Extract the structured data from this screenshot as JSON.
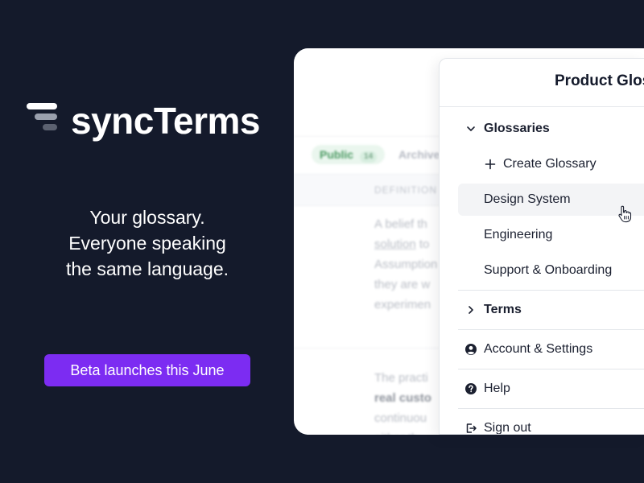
{
  "brand": {
    "name": "syncTerms",
    "tagline_lines": [
      "Your glossary.",
      "Everyone speaking",
      "the same language."
    ],
    "badge": "Beta launches this June",
    "badge_color": "#7c2cf2",
    "background_color": "#141a2b"
  },
  "background_app": {
    "tabs": [
      {
        "label": "Public",
        "count": "14"
      },
      {
        "label": "Archive"
      }
    ],
    "column_header": "DEFINITION",
    "paragraph_1": {
      "prefix": "A belief th",
      "link": "solution",
      "after_link": " to",
      "rest": [
        "Assumption",
        "they are w",
        "experimen"
      ]
    },
    "paragraph_2": {
      "lines": [
        "The practi",
        "real custo",
        "continuou",
        "either th"
      ]
    }
  },
  "menu": {
    "title": "Product Glos",
    "glossaries_label": "Glossaries",
    "create_label": "Create Glossary",
    "glossary_items": [
      "Design System",
      "Engineering",
      "Support & Onboarding"
    ],
    "terms_label": "Terms",
    "account_label": "Account & Settings",
    "help_label": "Help",
    "signout_label": "Sign out",
    "hovered_item": "Design System"
  }
}
